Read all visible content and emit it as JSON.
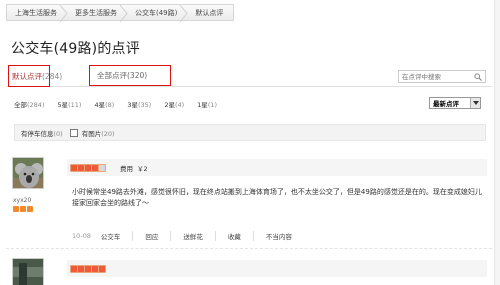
{
  "breadcrumb": {
    "items": [
      {
        "label": "上海生活服务"
      },
      {
        "label": "更多生活服务"
      },
      {
        "label": "公交车(49路)"
      },
      {
        "label": "默认点评"
      }
    ]
  },
  "page_title": "公交车(49路)的点评",
  "tabs": {
    "default": {
      "label": "默认点评",
      "count": "(284)"
    },
    "all": {
      "label": "全部点评",
      "count": "(320)"
    }
  },
  "search": {
    "placeholder": "在点评中搜索"
  },
  "filters": [
    {
      "label": "全部",
      "count": "(284)"
    },
    {
      "label": "5星",
      "count": "(11)"
    },
    {
      "label": "4星",
      "count": "(8)"
    },
    {
      "label": "3星",
      "count": "(35)"
    },
    {
      "label": "2星",
      "count": "(4)"
    },
    {
      "label": "1星",
      "count": "(1)"
    }
  ],
  "sort": {
    "selected": "最新点评"
  },
  "options": {
    "parking": {
      "label": "有停车信息",
      "count": "(0)"
    },
    "photos": {
      "label": "有图片",
      "count": "(20)"
    }
  },
  "reviews": [
    {
      "user": "xyx20",
      "user_level": 3,
      "rating": 4,
      "cost_label": "费用",
      "cost": "￥2",
      "text": "小时候常坐49路去外滩，感觉很怀旧，现在终点站搬到上海体育场了，也不太坐公交了，但是49路的感觉还是在的。现在变成媳妇儿接家回家会坐的路线了～",
      "date": "10-08",
      "actions": {
        "place": "公交车",
        "reply": "回应",
        "flower": "送鲜花",
        "favorite": "收藏",
        "report": "不当内容"
      }
    },
    {
      "rating": 5
    }
  ],
  "colors": {
    "highlight_border": "#dd1111",
    "star_on": "#ee5a3a",
    "user_flame": "#f08a2c"
  }
}
